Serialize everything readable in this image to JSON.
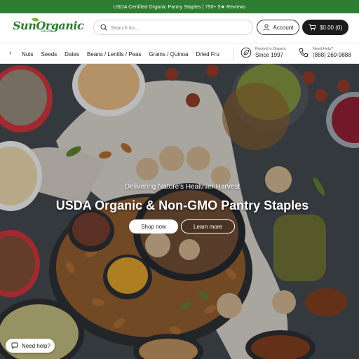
{
  "announcement": "USDA Certified Organic Pantry Staples | 750+ 5★ Reviews",
  "logo": {
    "name": "SunOrganic",
    "sub": "FARM"
  },
  "search": {
    "placeholder": "Search for..."
  },
  "header": {
    "account_label": "Account",
    "cart_label": "$0.00  (0)"
  },
  "nav": {
    "items": [
      {
        "label": "Nuts"
      },
      {
        "label": "Seeds"
      },
      {
        "label": "Dates"
      },
      {
        "label": "Beans / Lentils / Peas"
      },
      {
        "label": "Grains / Quinoa"
      },
      {
        "label": "Dried Fru"
      }
    ],
    "rooted": {
      "small": "Rooted in Organic",
      "big": "Since 1997"
    },
    "help": {
      "small": "Need Help?",
      "big": "(888) 269-9888"
    }
  },
  "hero": {
    "subtitle": "Delivering Nature's Healthier Harvest",
    "title": "USDA Organic & Non-GMO Pantry Staples",
    "shop_label": "Shop now",
    "learn_label": "Learn more"
  },
  "help_widget": {
    "label": "Need help?"
  },
  "colors": {
    "brand_green": "#2e7d32",
    "cart_bg": "#1c1c1c"
  },
  "icons": [
    "search-icon",
    "user-icon",
    "cart-icon",
    "chevron-left-icon",
    "leaf-badge-icon",
    "phone-icon",
    "chat-icon"
  ]
}
